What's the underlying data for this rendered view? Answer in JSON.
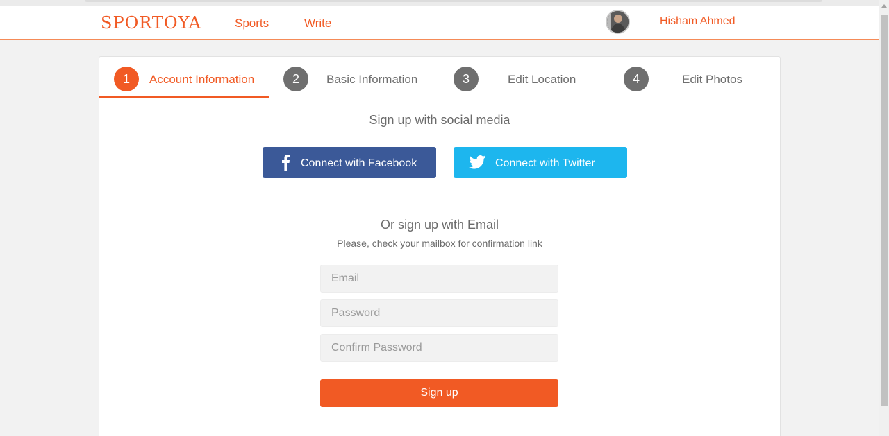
{
  "brand": {
    "logo": "SPORTOYA",
    "accent": "#f15a24"
  },
  "nav": {
    "sports": "Sports",
    "write": "Write"
  },
  "user": {
    "name": "Hisham Ahmed"
  },
  "steps": [
    {
      "num": "1",
      "label": "Account Information",
      "active": true
    },
    {
      "num": "2",
      "label": "Basic Information",
      "active": false
    },
    {
      "num": "3",
      "label": "Edit Location",
      "active": false
    },
    {
      "num": "4",
      "label": "Edit Photos",
      "active": false
    }
  ],
  "social": {
    "title": "Sign up with social media",
    "facebook": {
      "label": "Connect with Facebook",
      "icon": "facebook-icon",
      "color": "#3b5998"
    },
    "twitter": {
      "label": "Connect with Twitter",
      "icon": "twitter-icon",
      "color": "#1db6ee"
    }
  },
  "email_signup": {
    "title": "Or sign up with Email",
    "note": "Please, check your mailbox for confirmation link",
    "email_placeholder": "Email",
    "password_placeholder": "Password",
    "confirm_placeholder": "Confirm Password",
    "email_value": "",
    "password_value": "",
    "confirm_value": "",
    "submit": "Sign up"
  }
}
